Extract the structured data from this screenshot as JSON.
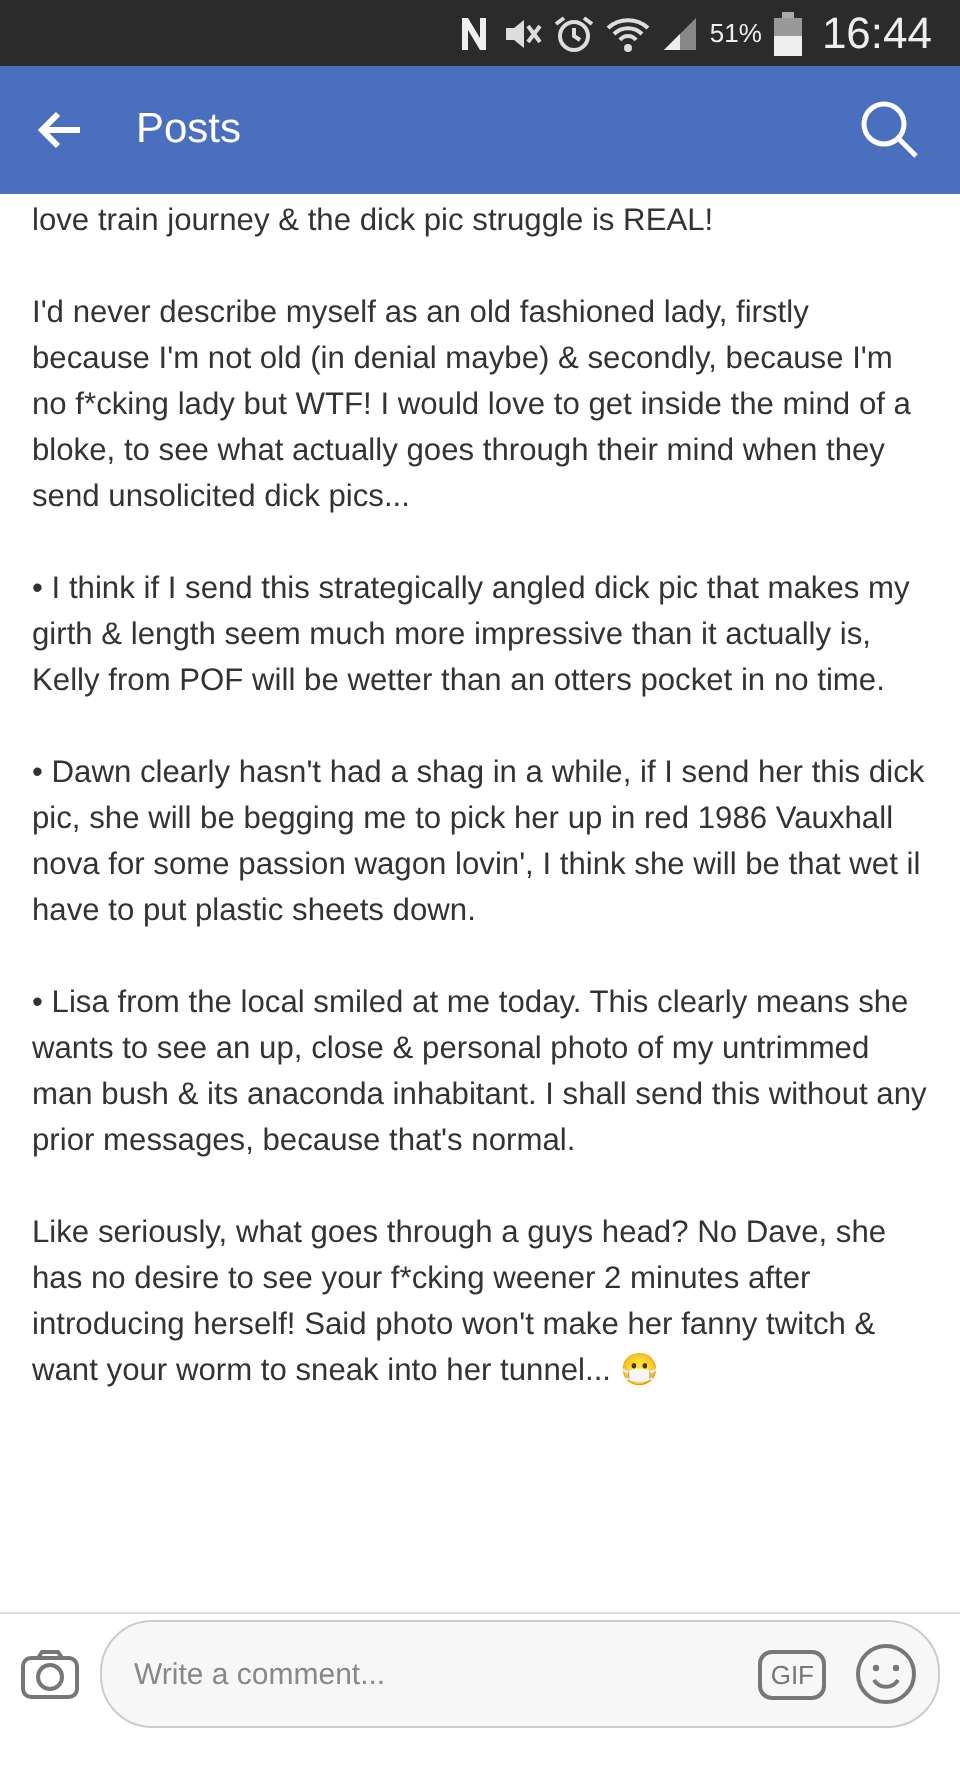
{
  "status_bar": {
    "battery_percent": "51%",
    "time": "16:44"
  },
  "header": {
    "title": "Posts"
  },
  "post": {
    "paragraphs": [
      "love train journey & the dick pic struggle is REAL!",
      "I'd never describe myself as an old fashioned lady, firstly because I'm not old (in denial maybe) & secondly, because I'm no f*cking lady but WTF! I would love to get inside the mind of a bloke, to see what actually goes through their mind when they send unsolicited dick pics...",
      "• I think if I send this strategically angled dick pic that makes my girth & length seem much more impressive than it actually is, Kelly from POF will be wetter than an otters pocket in no time.",
      "• Dawn clearly hasn't had a shag in a while, if I send her this dick pic, she will be begging me to pick her up in red 1986 Vauxhall nova for some passion wagon lovin', I think she will be that wet il have to put plastic sheets down.",
      "• Lisa from the local smiled at me today. This clearly means she wants to see an up, close &  personal photo of my untrimmed man bush & its anaconda inhabitant. I shall send this without any prior messages, because that's normal.",
      "Like seriously, what goes through a guys head? No Dave, she has no desire to see your f*cking weener 2 minutes after introducing herself! Said photo won't make her fanny twitch & want your worm to sneak into her tunnel... 😷"
    ]
  },
  "comment_bar": {
    "placeholder": "Write a comment...",
    "gif_label": "GIF"
  }
}
